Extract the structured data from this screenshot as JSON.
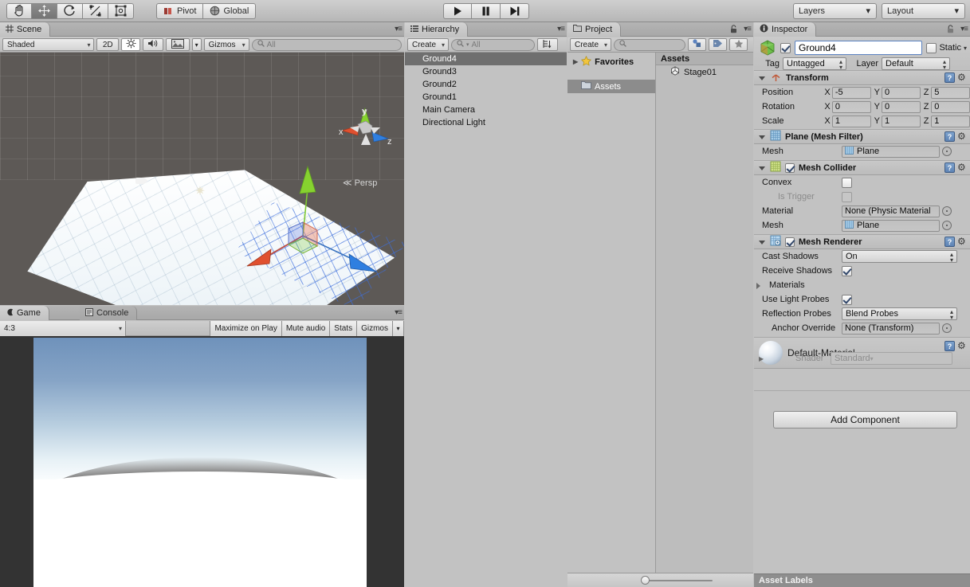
{
  "toolbar": {
    "tools": [
      {
        "name": "hand-tool",
        "icon": "hand-icon",
        "active": false
      },
      {
        "name": "move-tool",
        "icon": "move-icon",
        "active": true
      },
      {
        "name": "rotate-tool",
        "icon": "rotate-icon",
        "active": false
      },
      {
        "name": "scale-tool",
        "icon": "scale-icon",
        "active": false
      },
      {
        "name": "rect-tool",
        "icon": "rect-transform-icon",
        "active": false
      }
    ],
    "pivot_label": "Pivot",
    "global_label": "Global",
    "play_label": "Play",
    "pause_label": "Pause",
    "step_label": "Step",
    "layers_label": "Layers",
    "layout_label": "Layout"
  },
  "scene": {
    "tab_label": "Scene",
    "shading_mode": "Shaded",
    "mode_2d": "2D",
    "gizmos_label": "Gizmos",
    "search_placeholder": "All",
    "persp_label": "Persp",
    "axis_x": "x",
    "axis_y": "y",
    "axis_z": "z"
  },
  "game": {
    "tab_label": "Game",
    "console_tab_label": "Console",
    "aspect": "4:3",
    "maximize_label": "Maximize on Play",
    "mute_label": "Mute audio",
    "stats_label": "Stats",
    "gizmos_label": "Gizmos"
  },
  "hierarchy": {
    "tab_label": "Hierarchy",
    "create_label": "Create",
    "search_placeholder": "All",
    "items": [
      {
        "label": "Ground4",
        "selected": true
      },
      {
        "label": "Ground3",
        "selected": false
      },
      {
        "label": "Ground2",
        "selected": false
      },
      {
        "label": "Ground1",
        "selected": false
      },
      {
        "label": "Main Camera",
        "selected": false
      },
      {
        "label": "Directional Light",
        "selected": false
      }
    ]
  },
  "project": {
    "tab_label": "Project",
    "create_label": "Create",
    "search_placeholder": "",
    "favorites_label": "Favorites",
    "assets_tree_label": "Assets",
    "content_header": "Assets",
    "assets": [
      {
        "label": "Stage01",
        "icon": "unity-scene-icon"
      }
    ]
  },
  "inspector": {
    "tab_label": "Inspector",
    "object_name": "Ground4",
    "object_enabled": true,
    "static_label": "Static",
    "static_checked": false,
    "tag_label": "Tag",
    "tag_value": "Untagged",
    "layer_label": "Layer",
    "layer_value": "Default",
    "transform": {
      "title": "Transform",
      "position_label": "Position",
      "rotation_label": "Rotation",
      "scale_label": "Scale",
      "axis_x": "X",
      "axis_y": "Y",
      "axis_z": "Z",
      "position": {
        "x": "-5",
        "y": "0",
        "z": "5"
      },
      "rotation": {
        "x": "0",
        "y": "0",
        "z": "0"
      },
      "scale": {
        "x": "1",
        "y": "1",
        "z": "1"
      }
    },
    "mesh_filter": {
      "title": "Plane (Mesh Filter)",
      "mesh_label": "Mesh",
      "mesh_value": "Plane"
    },
    "mesh_collider": {
      "title": "Mesh Collider",
      "enabled": true,
      "convex_label": "Convex",
      "convex_checked": false,
      "is_trigger_label": "Is Trigger",
      "is_trigger_checked": false,
      "material_label": "Material",
      "material_value": "None (Physic Material",
      "mesh_label": "Mesh",
      "mesh_value": "Plane"
    },
    "mesh_renderer": {
      "title": "Mesh Renderer",
      "enabled": true,
      "cast_shadows_label": "Cast Shadows",
      "cast_shadows_value": "On",
      "receive_shadows_label": "Receive Shadows",
      "receive_shadows_checked": true,
      "materials_label": "Materials",
      "use_light_probes_label": "Use Light Probes",
      "use_light_probes_checked": true,
      "reflection_probes_label": "Reflection Probes",
      "reflection_probes_value": "Blend Probes",
      "anchor_override_label": "Anchor Override",
      "anchor_override_value": "None (Transform)"
    },
    "material": {
      "name": "Default-Material",
      "shader_label": "Shader",
      "shader_value": "Standard"
    },
    "add_component_label": "Add Component",
    "asset_labels_title": "Asset Labels"
  }
}
